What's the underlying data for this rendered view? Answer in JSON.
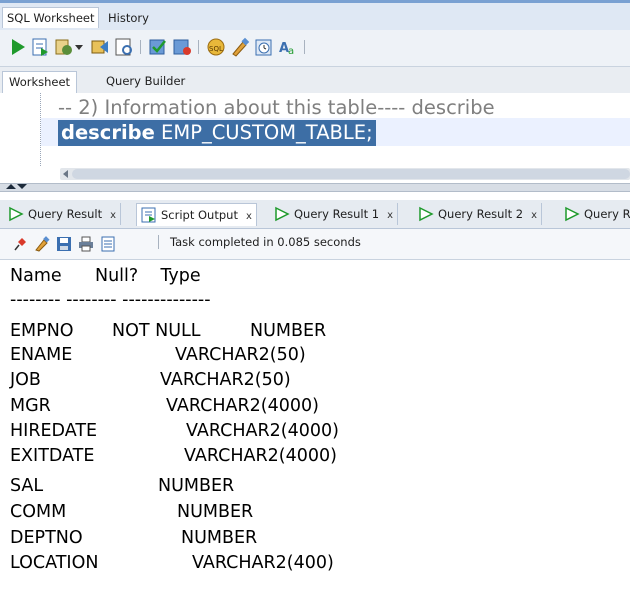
{
  "top_tabs": [
    "SQL Worksheet",
    "History"
  ],
  "worksheet_tabs": [
    "Worksheet",
    "Query Builder"
  ],
  "editor": {
    "line1": "-- 2) Information about this table---- describe",
    "line2_keyword": "describe",
    "line2_rest": " EMP_CUSTOM_TABLE;"
  },
  "result_tabs": [
    {
      "label": "Query Result",
      "close": "x"
    },
    {
      "label": "Script Output",
      "close": "x"
    },
    {
      "label": "Query Result 1",
      "close": "x"
    },
    {
      "label": "Query Result 2",
      "close": "x"
    },
    {
      "label": "Query R",
      "close": ""
    }
  ],
  "status": "Task completed in 0.085 seconds",
  "output": {
    "header": "Name      Null?    Type",
    "rule": "-------- -------- --------------",
    "rows": [
      {
        "name": "EMPNO",
        "null": "NOT NULL",
        "type": "NUMBER"
      },
      {
        "name": "ENAME",
        "null": "",
        "type": "VARCHAR2(50)"
      },
      {
        "name": "JOB",
        "null": "",
        "type": "VARCHAR2(50)"
      },
      {
        "name": "MGR",
        "null": "",
        "type": "VARCHAR2(4000)"
      },
      {
        "name": "HIREDATE",
        "null": "",
        "type": "VARCHAR2(4000)"
      },
      {
        "name": "EXITDATE",
        "null": "",
        "type": "VARCHAR2(4000)"
      },
      {
        "name": "SAL",
        "null": "",
        "type": "NUMBER"
      },
      {
        "name": "COMM",
        "null": "",
        "type": "NUMBER"
      },
      {
        "name": "DEPTNO",
        "null": "",
        "type": "NUMBER"
      },
      {
        "name": "LOCATION",
        "null": "",
        "type": "VARCHAR2(400)"
      }
    ]
  },
  "icons": [
    "run-statement-icon",
    "run-script-icon",
    "autotrace-icon",
    "explain-plan-icon",
    "commit-icon",
    "rollback-icon",
    "sql-tuning-icon",
    "clear-icon",
    "history-icon",
    "format-icon"
  ]
}
